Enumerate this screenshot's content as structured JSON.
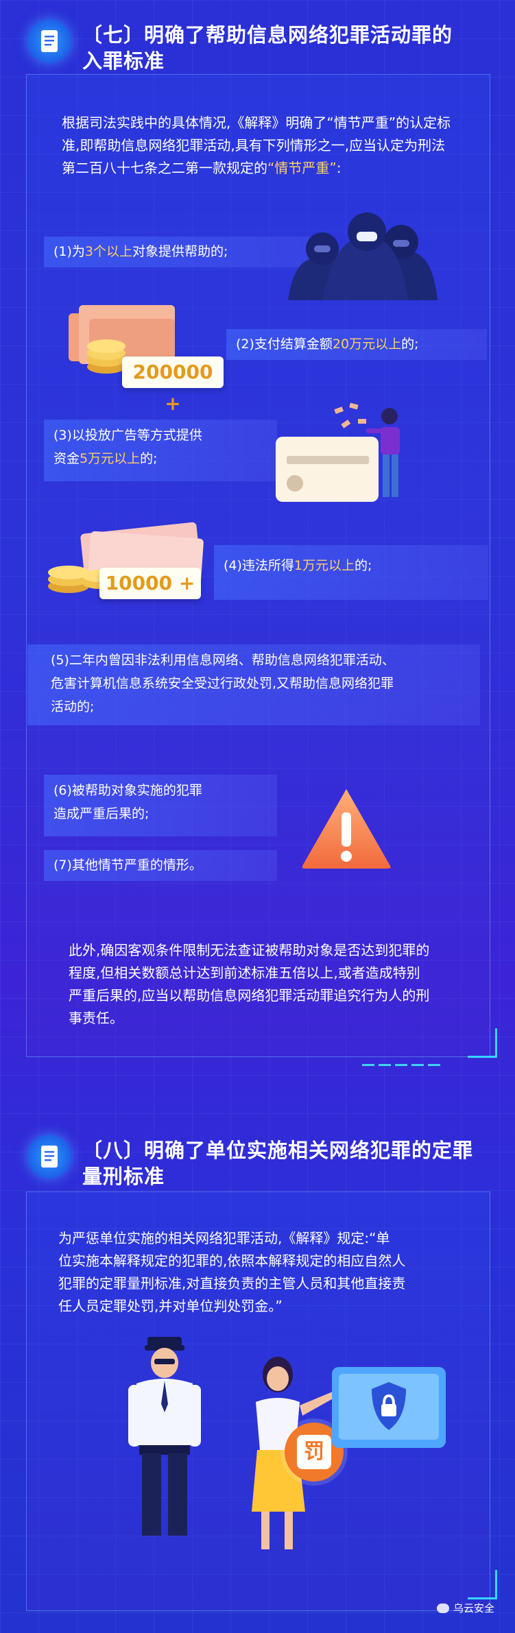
{
  "section7": {
    "title_line1": "〔七〕明确了帮助信息网络犯罪活动罪的",
    "title_line2": "入罪标准",
    "intro_part1": "根据司法实践中的具体情况,《解释》明确了“情节严重”的认定标准,即帮助信息网络犯罪活动,具有下列情形之一,应当认定为刑法第二百八十七条之二第一款规定的",
    "intro_highlight": "“情节严重”",
    "intro_end": ":",
    "items": {
      "item1_prefix": "(1)为",
      "item1_highlight": "3个以上",
      "item1_suffix": "对象提供帮助的;",
      "item2_prefix": "(2)支付结算金额",
      "item2_highlight": "20万元以上",
      "item2_suffix": "的;",
      "item3_line1": "(3)以投放广告等方式提供",
      "item3_prefix": "资金",
      "item3_highlight": "5万元以上",
      "item3_suffix": "的;",
      "item4_prefix": "(4)违法所得",
      "item4_highlight": "1万元以上",
      "item4_suffix": "的;",
      "item5_line1": "(5)二年内曾因非法利用信息网络、帮助信息网络犯罪活动、",
      "item5_line2": "危害计算机信息系统安全受过行政处罚,又帮助信息网络犯罪",
      "item5_line3": "活动的;",
      "item6_line1": "(6)被帮助对象实施的犯罪",
      "item6_line2": "造成严重后果的;",
      "item7": "(7)其他情节严重的情形。"
    },
    "badge_200000": "200000 +",
    "badge_10000": "10000 +",
    "closing_line1": "此外,确因客观条件限制无法查证被帮助对象是否达到犯罪的",
    "closing_line2": "程度,但相关数额总计达到前述标准五倍以上,或者造成特别",
    "closing_line3": "严重后果的,应当以帮助信息网络犯罪活动罪追究行为人的刑",
    "closing_line4": "事责任。"
  },
  "section8": {
    "title_line1": "〔八〕明确了单位实施相关网络犯罪的定罪",
    "title_line2": "量刑标准",
    "para_line1": "为严惩单位实施的相关网络犯罪活动,《解释》规定:“单",
    "para_line2": "位实施本解释规定的犯罪的,依照本解释规定的相应自然人",
    "para_line3": "犯罪的定罪量刑标准,对直接负责的主管人员和其他直接责",
    "para_line4": "任人员定罪处罚,并对单位判处罚金。”",
    "stamp_text": "罚"
  },
  "watermark": "乌云安全",
  "colors": {
    "accent": "#ffd166",
    "cyan": "#36d6ff",
    "background": "#2a2fd6"
  },
  "icons": [
    "document-icon",
    "hacker-figures-icon",
    "coins-icon",
    "credit-card-icon",
    "money-thrower-icon",
    "cash-stack-icon",
    "warning-triangle-icon",
    "police-officer-icon",
    "woman-presenter-icon",
    "shield-lock-screen-icon",
    "wechat-icon"
  ]
}
